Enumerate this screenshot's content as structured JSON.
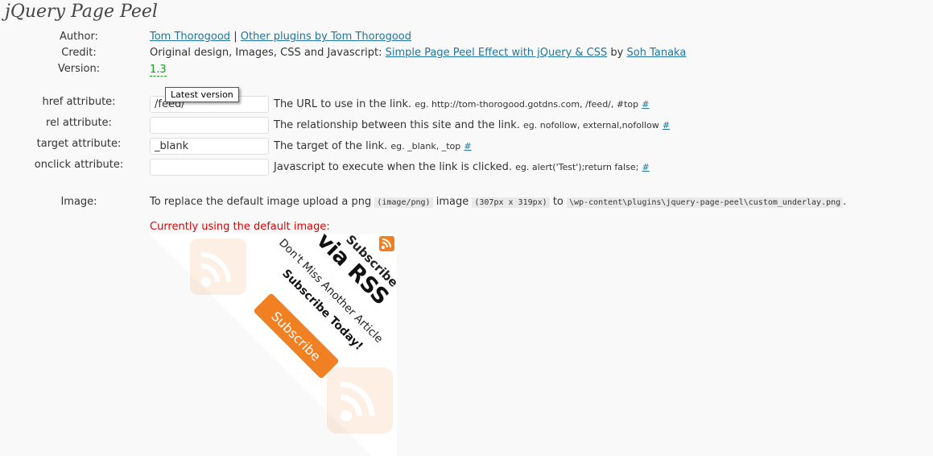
{
  "plugin": {
    "title": "jQuery Page Peel",
    "author_label": "Author:",
    "author_name": "Tom Thorogood",
    "author_sep": "|",
    "other_plugins": "Other plugins by Tom Thorogood",
    "credit_label": "Credit:",
    "credit_text": "Original design, Images, CSS and Javascript:",
    "credit_link": "Simple Page Peel Effect with jQuery & CSS",
    "credit_by": "by",
    "credit_author": "Soh Tanaka",
    "version_label": "Version:",
    "version": "1.3",
    "version_tooltip": "Latest version"
  },
  "fields": [
    {
      "label": "href attribute:",
      "value": "/feed/",
      "description": "The URL to use in the link.",
      "example": "eg. http://tom-thorogood.gotdns.com, /feed/, #top",
      "hash": "#"
    },
    {
      "label": "rel attribute:",
      "value": "",
      "description": "The relationship between this site and the link.",
      "example": "eg. nofollow, external,nofollow",
      "hash": "#"
    },
    {
      "label": "target attribute:",
      "value": "_blank",
      "description": "The target of the link.",
      "example": "eg. _blank, _top",
      "hash": "#"
    },
    {
      "label": "onclick attribute:",
      "value": "",
      "description": "Javascript to execute when the link is clicked.",
      "example": "eg. alert('Test');return false;",
      "hash": "#"
    }
  ],
  "image": {
    "label": "Image:",
    "text1": "To replace the default image upload a png",
    "mime": "(image/png)",
    "text2": "image",
    "size": "(307px x 319px)",
    "text3": "to",
    "path": "\\wp-content\\plugins\\jquery-page-peel\\custom_underlay.png",
    "text4": ".",
    "default_note": "Currently using the default image:"
  },
  "peel": {
    "line1": "Subscribe",
    "line2": "via RSS",
    "line3": "Don't Miss Another Article",
    "line4": "Subscribe Today!",
    "button": "Subscribe"
  },
  "colors": {
    "link": "#21759b",
    "version": "#1c9b1c",
    "note": "#dd0000",
    "rss_orange": "#f08022"
  }
}
